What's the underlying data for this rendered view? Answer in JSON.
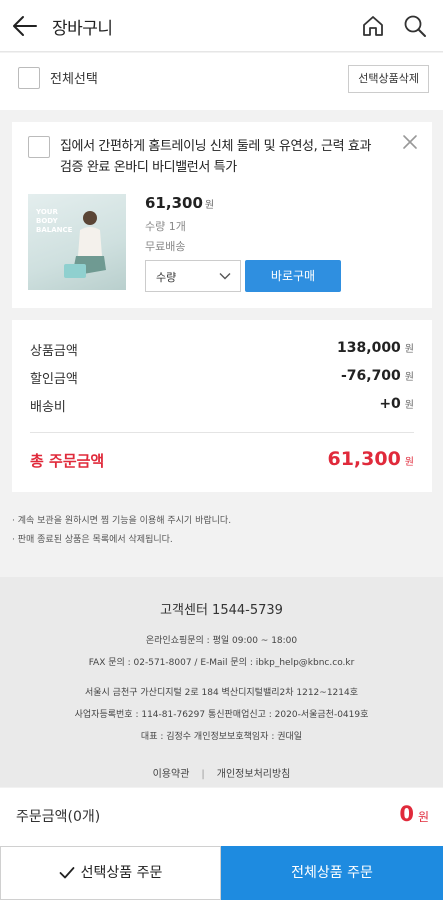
{
  "header": {
    "title": "장바구니",
    "back_icon": "back-arrow-icon",
    "home_icon": "home-icon",
    "search_icon": "search-icon"
  },
  "select_bar": {
    "select_all_label": "전체선택",
    "delete_selected_label": "선택상품삭제"
  },
  "cart_item": {
    "name": "집에서 간편하게 홈트레이닝 신체 둘레 및 유연성, 근력 효과 검증 완료 온바디 바디밸런서 특가",
    "price": "61,300",
    "price_unit": "원",
    "quantity": "수량 1개",
    "shipping": "무료배송",
    "qty_select_label": "수량",
    "buy_now_label": "바로구매",
    "thumb_text": [
      "YOUR",
      "BODY",
      "BALANCE"
    ]
  },
  "summary": {
    "rows": [
      {
        "label": "상품금액",
        "value": "138,000",
        "unit": "원"
      },
      {
        "label": "할인금액",
        "value": "-76,700",
        "unit": "원"
      },
      {
        "label": "배송비",
        "value": "+0",
        "unit": "원"
      }
    ],
    "total_label": "총 주문금액",
    "total_value": "61,300",
    "total_unit": "원"
  },
  "notes": [
    "· 계속 보관을 원하시면 찜 기능을 이용해 주시기 바랍니다.",
    "· 판매 종료된 상품은 목록에서 삭제됩니다."
  ],
  "footer": {
    "cs_title": "고객센터 1544-5739",
    "lines": [
      "온라인쇼핑문의 : 평일 09:00 ~ 18:00",
      "FAX 문의 : 02-571-8007 / E-Mail 문의 : ibkp_help@kbnc.co.kr",
      "서울시 금천구 가산디지털 2로 184 벽산디지털밸리2차 1212~1214호",
      "사업자등록번호 : 114-81-76297 통신판매업신고 : 2020-서울금천-0419호",
      "대표 : 김정수 개인정보보호책임자 : 권대일"
    ],
    "links": [
      "이용약관",
      "개인정보처리방침"
    ],
    "separator": "|"
  },
  "order_bar": {
    "label": "주문금액(0개)",
    "value": "0",
    "unit": "원"
  },
  "bottom_buttons": {
    "order_selected_label": "선택상품 주문",
    "order_all_label": "전체상품 주문"
  },
  "colors": {
    "accent_blue": "#1e8be0",
    "price_red": "#e02a3b"
  }
}
